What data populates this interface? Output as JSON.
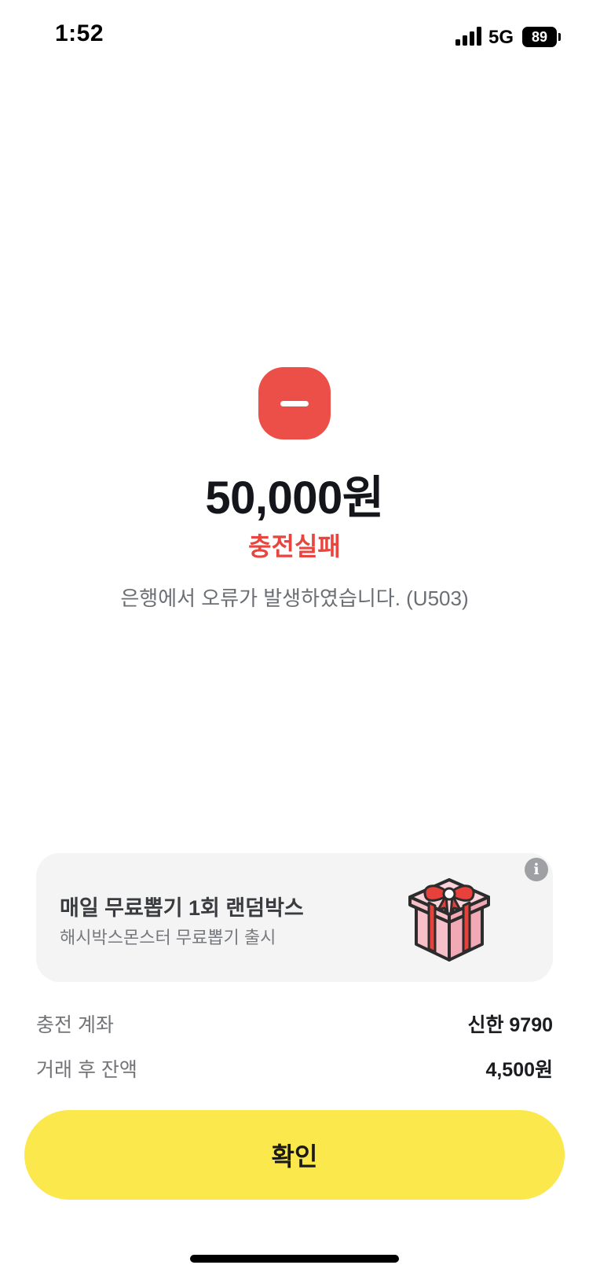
{
  "status_bar": {
    "time": "1:52",
    "network": "5G",
    "battery": "89"
  },
  "result": {
    "amount": "50,000원",
    "status": "충전실패",
    "message": "은행에서 오류가 발생하였습니다. (U503)",
    "status_color": "#e9453f",
    "icon": "minus-icon"
  },
  "promo": {
    "title": "매일 무료뽑기 1회 랜덤박스",
    "subtitle": "해시박스몬스터 무료뽑기 출시",
    "info_icon_glyph": "i",
    "image": "gift-box-icon"
  },
  "details": [
    {
      "label": "충전 계좌",
      "value": "신한 9790"
    },
    {
      "label": "거래 후 잔액",
      "value": "4,500원"
    }
  ],
  "confirm_button": {
    "label": "확인",
    "color": "#fbe84c"
  }
}
